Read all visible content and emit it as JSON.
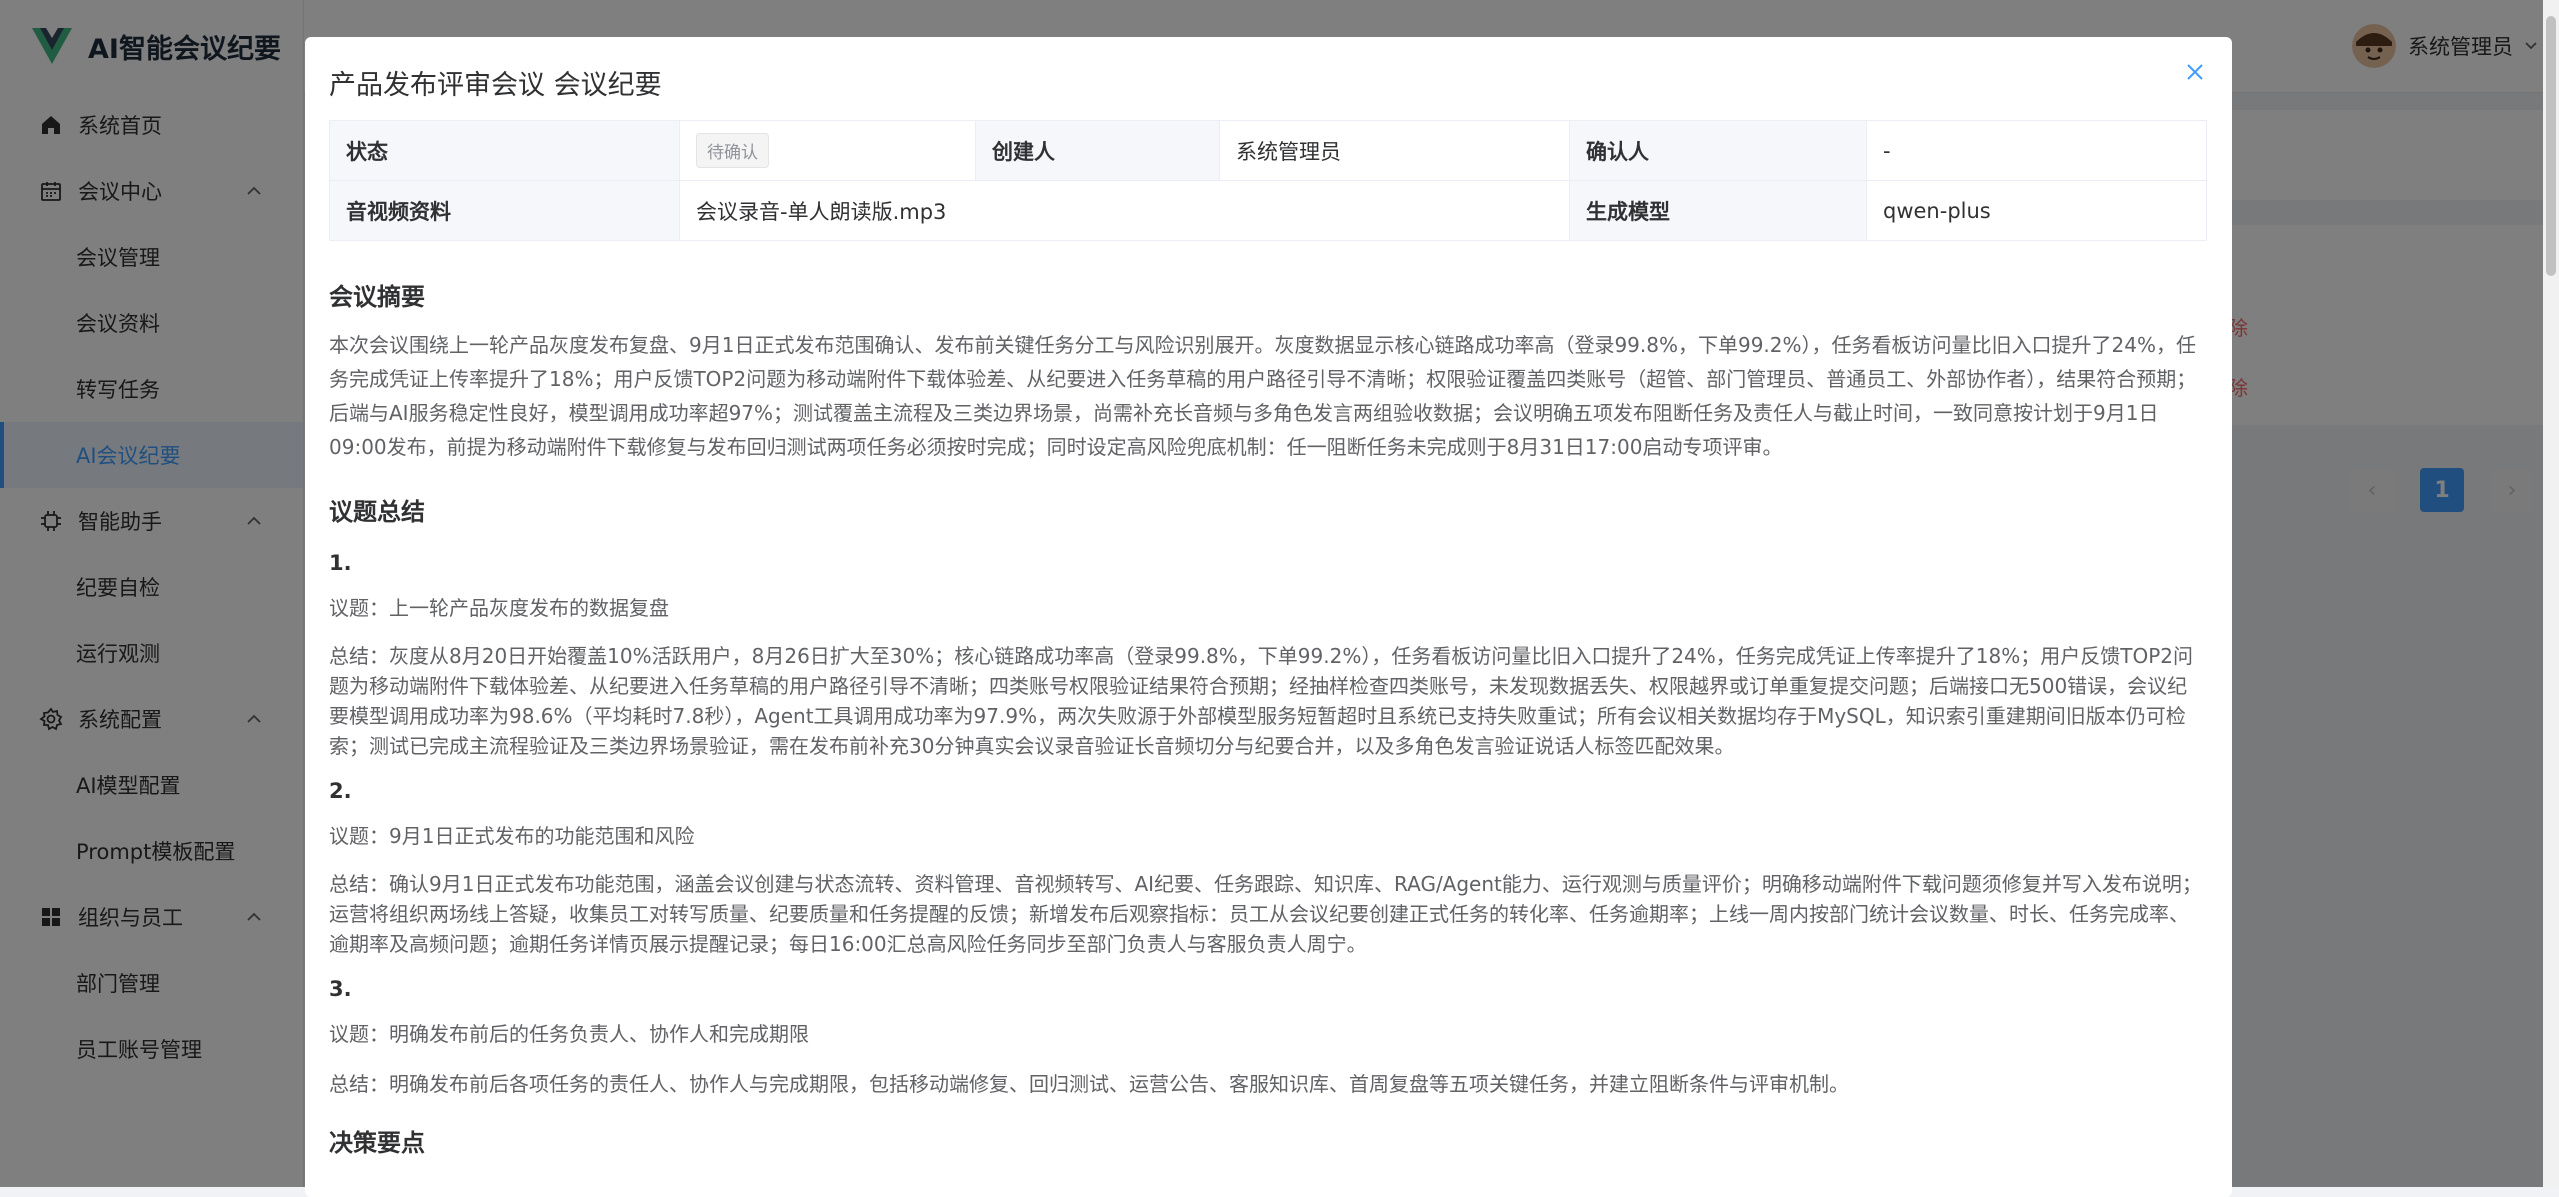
{
  "app": {
    "title": "AI智能会议纪要",
    "brand_color": "#409eff"
  },
  "sidebar": {
    "items": [
      {
        "label": "系统首页",
        "icon": "home-icon"
      },
      {
        "label": "会议中心",
        "icon": "calendar-icon",
        "expanded": true
      },
      {
        "label": "会议管理"
      },
      {
        "label": "会议资料"
      },
      {
        "label": "转写任务"
      },
      {
        "label": "AI会议纪要",
        "active": true
      },
      {
        "label": "智能助手",
        "icon": "cpu-icon",
        "expanded": true
      },
      {
        "label": "纪要自检"
      },
      {
        "label": "运行观测"
      },
      {
        "label": "系统配置",
        "icon": "gear-icon",
        "expanded": true
      },
      {
        "label": "AI模型配置"
      },
      {
        "label": "Prompt模板配置"
      },
      {
        "label": "组织与员工",
        "icon": "grid-icon",
        "expanded": true
      },
      {
        "label": "部门管理"
      },
      {
        "label": "员工账号管理"
      }
    ]
  },
  "header": {
    "user_name": "系统管理员"
  },
  "background_page": {
    "delete_label_1": "除",
    "delete_label_2": "除",
    "pager": {
      "prev": "‹",
      "current": "1",
      "next": "›"
    }
  },
  "dialog": {
    "title": "产品发布评审会议 会议纪要",
    "info": {
      "status_label": "状态",
      "status_value": "待确认",
      "creator_label": "创建人",
      "creator_value": "系统管理员",
      "confirmer_label": "确认人",
      "confirmer_value": "-",
      "media_label": "音视频资料",
      "media_value": "会议录音-单人朗读版.mp3",
      "model_label": "生成模型",
      "model_value": "qwen-plus"
    },
    "summary_title": "会议摘要",
    "summary_text": "本次会议围绕上一轮产品灰度发布复盘、9月1日正式发布范围确认、发布前关键任务分工与风险识别展开。灰度数据显示核心链路成功率高（登录99.8%，下单99.2%），任务看板访问量比旧入口提升了24%，任务完成凭证上传率提升了18%；用户反馈TOP2问题为移动端附件下载体验差、从纪要进入任务草稿的用户路径引导不清晰；权限验证覆盖四类账号（超管、部门管理员、普通员工、外部协作者），结果符合预期；后端与AI服务稳定性良好，模型调用成功率超97%；测试覆盖主流程及三类边界场景，尚需补充长音频与多角色发言两组验收数据；会议明确五项发布阻断任务及责任人与截止时间，一致同意按计划于9月1日09:00发布，前提为移动端附件下载修复与发布回归测试两项任务必须按时完成；同时设定高风险兜底机制：任一阻断任务未完成则于8月31日17:00启动专项评审。",
    "topics_title": "议题总结",
    "topics": [
      {
        "num": "1.",
        "topic": "议题：上一轮产品灰度发布的数据复盘",
        "summary": "总结：灰度从8月20日开始覆盖10%活跃用户，8月26日扩大至30%；核心链路成功率高（登录99.8%，下单99.2%），任务看板访问量比旧入口提升了24%，任务完成凭证上传率提升了18%；用户反馈TOP2问题为移动端附件下载体验差、从纪要进入任务草稿的用户路径引导不清晰；四类账号权限验证结果符合预期；经抽样检查四类账号，未发现数据丢失、权限越界或订单重复提交问题；后端接口无500错误，会议纪要模型调用成功率为98.6%（平均耗时7.8秒），Agent工具调用成功率为97.9%，两次失败源于外部模型服务短暂超时且系统已支持失败重试；所有会议相关数据均存于MySQL，知识索引重建期间旧版本仍可检索；测试已完成主流程验证及三类边界场景验证，需在发布前补充30分钟真实会议录音验证长音频切分与纪要合并，以及多角色发言验证说话人标签匹配效果。"
      },
      {
        "num": "2.",
        "topic": "议题：9月1日正式发布的功能范围和风险",
        "summary": "总结：确认9月1日正式发布功能范围，涵盖会议创建与状态流转、资料管理、音视频转写、AI纪要、任务跟踪、知识库、RAG/Agent能力、运行观测与质量评价；明确移动端附件下载问题须修复并写入发布说明；运营将组织两场线上答疑，收集员工对转写质量、纪要质量和任务提醒的反馈；新增发布后观察指标：员工从会议纪要创建正式任务的转化率、任务逾期率；上线一周内按部门统计会议数量、时长、任务完成率、逾期率及高频问题；逾期任务详情页展示提醒记录；每日16:00汇总高风险任务同步至部门负责人与客服负责人周宁。"
      },
      {
        "num": "3.",
        "topic": "议题：明确发布前后的任务负责人、协作人和完成期限",
        "summary": "总结：明确发布前后各项任务的责任人、协作人与完成期限，包括移动端修复、回归测试、运营公告、客服知识库、首周复盘等五项关键任务，并建立阻断条件与评审机制。"
      }
    ],
    "decisions_title": "决策要点"
  }
}
